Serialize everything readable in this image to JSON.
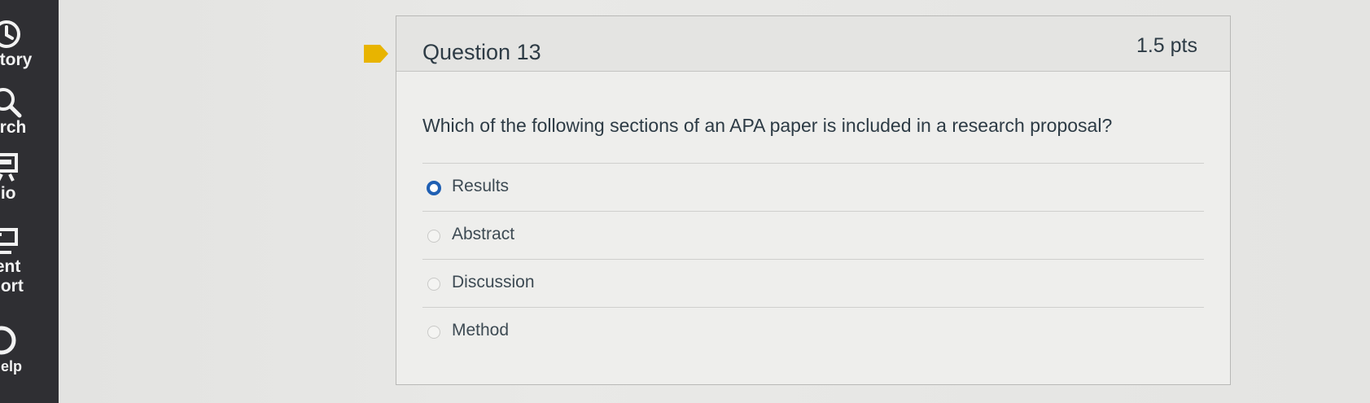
{
  "nav": {
    "items": [
      {
        "label": "story",
        "icon": "history-clock-icon"
      },
      {
        "label": "arch",
        "icon": "search-magnifier-icon"
      },
      {
        "label": "dio",
        "icon": "studio-icon"
      },
      {
        "label": "lent",
        "icon": "student-support-icon"
      },
      {
        "label": "port",
        "icon": ""
      },
      {
        "label": "Help",
        "icon": "help-icon"
      }
    ]
  },
  "question": {
    "title": "Question 13",
    "points": "1.5 pts",
    "text": "Which of the following sections of an APA paper is included in a research proposal?",
    "answers": [
      {
        "label": "Results",
        "selected": true
      },
      {
        "label": "Abstract",
        "selected": false
      },
      {
        "label": "Discussion",
        "selected": false
      },
      {
        "label": "Method",
        "selected": false
      }
    ],
    "flag_color": "#e8b400",
    "selected_radio_color": "#1f5fb3"
  }
}
